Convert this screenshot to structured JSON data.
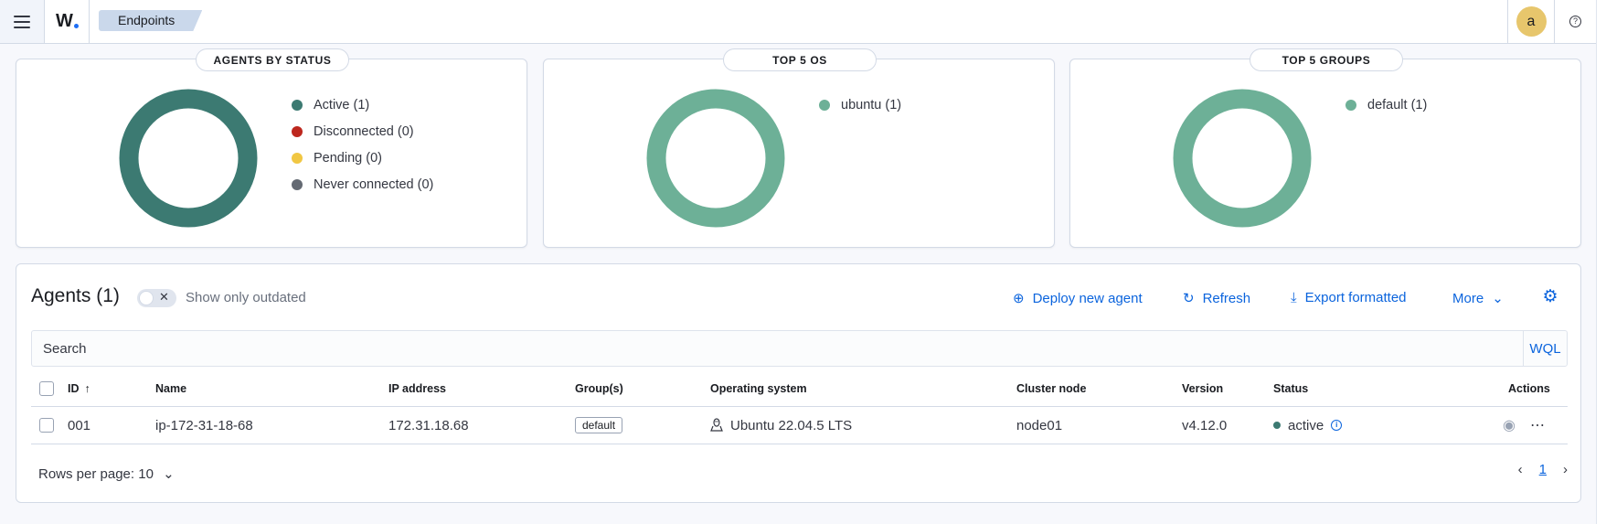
{
  "header": {
    "breadcrumb": "Endpoints",
    "avatar_initial": "a",
    "logo_letter": "W"
  },
  "panels": {
    "status": {
      "title": "AGENTS BY STATUS",
      "legend": [
        {
          "label": "Active (1)",
          "color": "#3c7a72"
        },
        {
          "label": "Disconnected (0)",
          "color": "#bd271e"
        },
        {
          "label": "Pending (0)",
          "color": "#f1c743"
        },
        {
          "label": "Never connected (0)",
          "color": "#646a73"
        }
      ]
    },
    "os": {
      "title": "TOP 5 OS",
      "legend": [
        {
          "label": "ubuntu (1)",
          "color": "#6db097"
        }
      ]
    },
    "groups": {
      "title": "TOP 5 GROUPS",
      "legend": [
        {
          "label": "default (1)",
          "color": "#6db097"
        }
      ]
    }
  },
  "agents": {
    "title": "Agents (1)",
    "toggle_label": "Show only outdated",
    "actions": {
      "deploy": "Deploy new agent",
      "refresh": "Refresh",
      "export": "Export formatted",
      "more": "More"
    },
    "search_placeholder": "Search",
    "wql": "WQL",
    "columns": [
      "ID",
      "Name",
      "IP address",
      "Group(s)",
      "Operating system",
      "Cluster node",
      "Version",
      "Status",
      "Actions"
    ],
    "rows": [
      {
        "id": "001",
        "name": "ip-172-31-18-68",
        "ip": "172.31.18.68",
        "group": "default",
        "os": "Ubuntu 22.04.5 LTS",
        "node": "node01",
        "version": "v4.12.0",
        "status": "active",
        "status_color": "#3c7a72"
      }
    ],
    "rows_per_page": "Rows per page: 10",
    "current_page": "1"
  }
}
